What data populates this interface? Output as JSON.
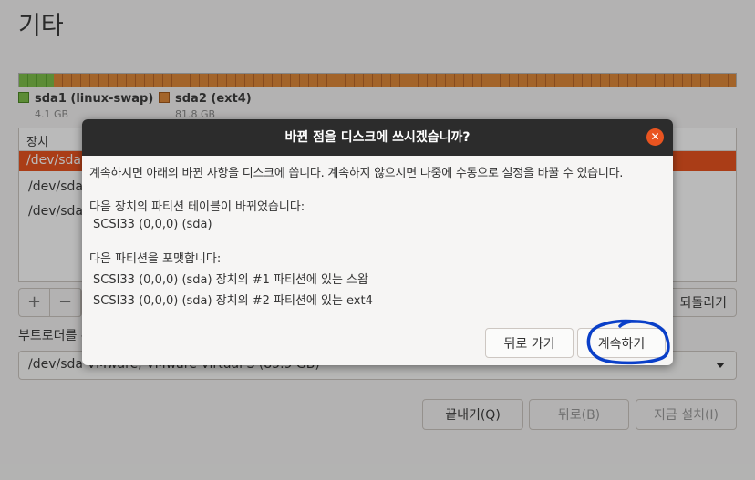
{
  "page": {
    "title": "기타"
  },
  "partitions": [
    {
      "name": "sda1 (linux-swap)",
      "size": "4.1 GB",
      "color": "#7ec04a"
    },
    {
      "name": "sda2 (ext4)",
      "size": "81.8 GB",
      "color": "#e08a3a"
    }
  ],
  "device_list": {
    "header": "장치",
    "rows": [
      "/dev/sda",
      "/dev/sda",
      "/dev/sda"
    ]
  },
  "controls": {
    "add": "+",
    "remove": "−",
    "revert": "되돌리기"
  },
  "bootloader": {
    "label": "부트로더를 -",
    "value": "/dev/sda   VMware, VMware Virtual S (85.9 GB)"
  },
  "footer": {
    "quit": "끝내기(Q)",
    "back": "뒤로(B)",
    "install": "지금 설치(I)"
  },
  "dialog": {
    "title": "바뀐 점을 디스크에 쓰시겠습니까?",
    "intro": "계속하시면 아래의 바뀐 사항을 디스크에 씁니다. 계속하지 않으시면 나중에 수동으로 설정을 바꿀 수 있습니다.",
    "table_heading": "다음 장치의 파티션 테이블이 바뀌었습니다:",
    "table_device": "SCSI33 (0,0,0) (sda)",
    "format_heading": "다음 파티션을 포맷합니다:",
    "format_items": [
      "SCSI33 (0,0,0) (sda) 장치의 #1 파티션에 있는 스왑",
      "SCSI33 (0,0,0) (sda) 장치의 #2 파티션에 있는 ext4"
    ],
    "back_button": "뒤로 가기",
    "continue_button": "계속하기",
    "close": "✕"
  },
  "colors": {
    "accent": "#e95420",
    "titlebar": "#2c2c2c",
    "annotation": "#0a3fc8"
  },
  "icons": {
    "close": "close-icon",
    "dropdown": "chevron-down-icon"
  }
}
